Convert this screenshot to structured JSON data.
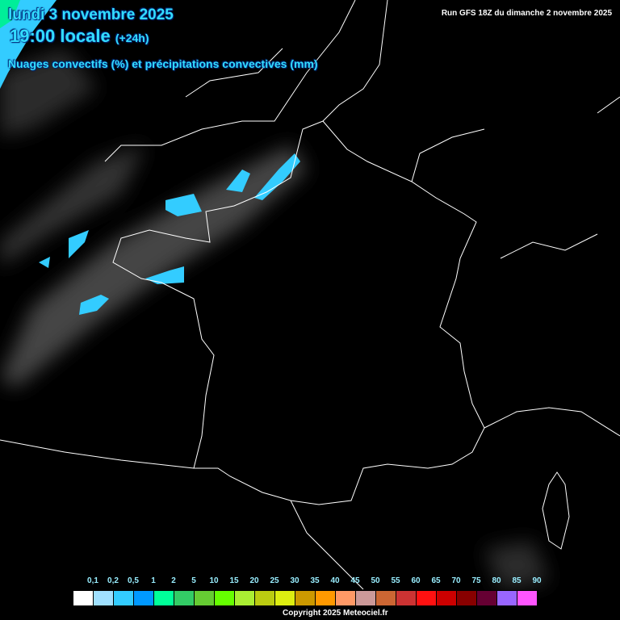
{
  "header": {
    "date": "lundi 3 novembre 2025",
    "time": "19:00 locale",
    "offset": "(+24h)",
    "parameter": "Nuages convectifs (%) et précipitations convectives (mm)",
    "run": "Run GFS 18Z du dimanche 2 novembre 2025"
  },
  "legend": {
    "labels": [
      "0,1",
      "0,2",
      "0,5",
      "1",
      "2",
      "5",
      "10",
      "15",
      "20",
      "25",
      "30",
      "35",
      "40",
      "45",
      "50",
      "55",
      "60",
      "65",
      "70",
      "75",
      "80",
      "85",
      "90"
    ],
    "colors": [
      "#ffffff",
      "#a0e0ff",
      "#33ccff",
      "#0099ff",
      "#00ff99",
      "#33cc66",
      "#66cc33",
      "#66ff00",
      "#aaee33",
      "#bbcc11",
      "#ddee11",
      "#cc9900",
      "#ff9900",
      "#ff9966",
      "#cc9999",
      "#cc6633",
      "#cc3333",
      "#ff1111",
      "#cc0000",
      "#880000",
      "#660033",
      "#9966ff",
      "#ff55ff"
    ]
  },
  "footer": {
    "copyright": "Copyright 2025 Meteociel.fr"
  }
}
